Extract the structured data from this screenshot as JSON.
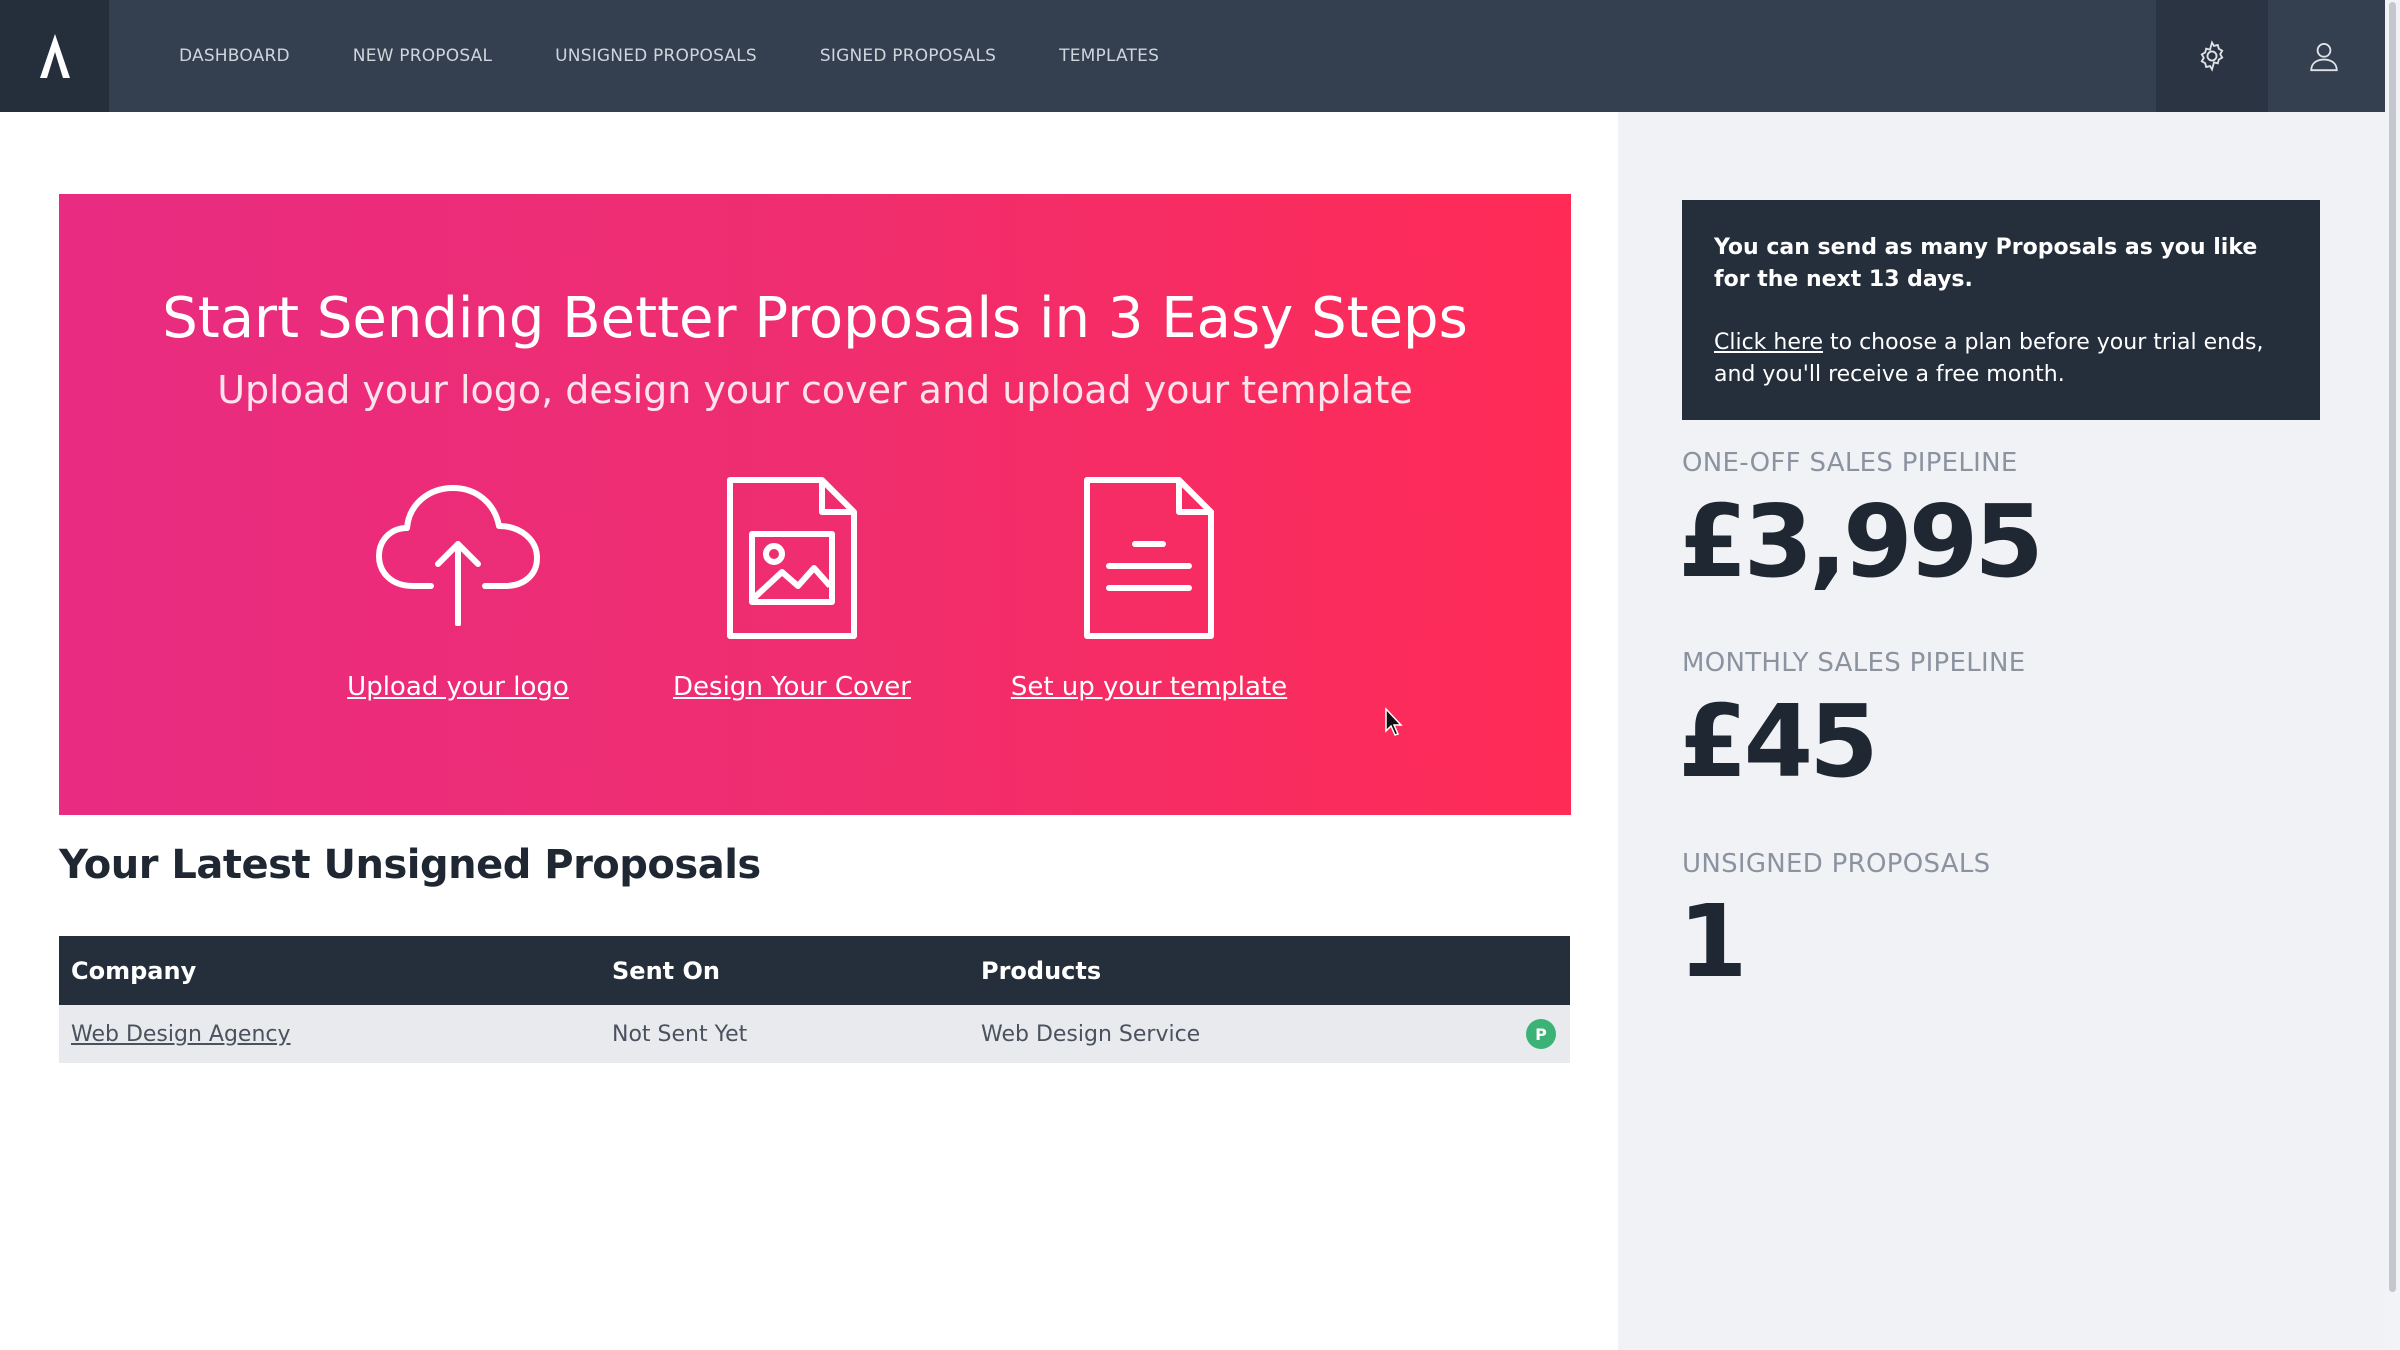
{
  "nav": {
    "logo_icon": "brand-logo-icon",
    "items": [
      {
        "label": "DASHBOARD"
      },
      {
        "label": "NEW PROPOSAL"
      },
      {
        "label": "UNSIGNED PROPOSALS"
      },
      {
        "label": "SIGNED PROPOSALS"
      },
      {
        "label": "TEMPLATES"
      }
    ],
    "settings_icon": "gear-icon",
    "user_icon": "user-icon"
  },
  "hero": {
    "title": "Start Sending Better Proposals in 3 Easy Steps",
    "subtitle": "Upload your logo, design your cover and upload your template",
    "steps": [
      {
        "icon": "cloud-upload-icon",
        "label": "Upload your logo"
      },
      {
        "icon": "image-file-icon",
        "label": "Design Your Cover"
      },
      {
        "icon": "document-icon",
        "label": "Set up your template"
      }
    ],
    "gradient": [
      "#e92c82",
      "#ff2b56"
    ]
  },
  "unsigned": {
    "title": "Your Latest Unsigned Proposals",
    "columns": [
      "Company",
      "Sent On",
      "Products"
    ],
    "rows": [
      {
        "company": "Web Design Agency",
        "sent_on": "Not Sent Yet",
        "products": "Web Design Service",
        "badge": "P"
      }
    ]
  },
  "sidebar": {
    "trial_bold": "You can send as many Proposals as you like for the next 13 days.",
    "trial_link": "Click here",
    "trial_rest": " to choose a plan before your trial ends, and you'll receive a free month.",
    "stats": [
      {
        "label": "ONE-OFF SALES PIPELINE",
        "value": "£3,995"
      },
      {
        "label": "MONTHLY SALES PIPELINE",
        "value": "£45"
      },
      {
        "label": "UNSIGNED PROPOSALS",
        "value": "1"
      }
    ]
  },
  "colors": {
    "nav_bg": "#343f4f",
    "dark": "#252e3b",
    "badge_green": "#3cb376"
  }
}
